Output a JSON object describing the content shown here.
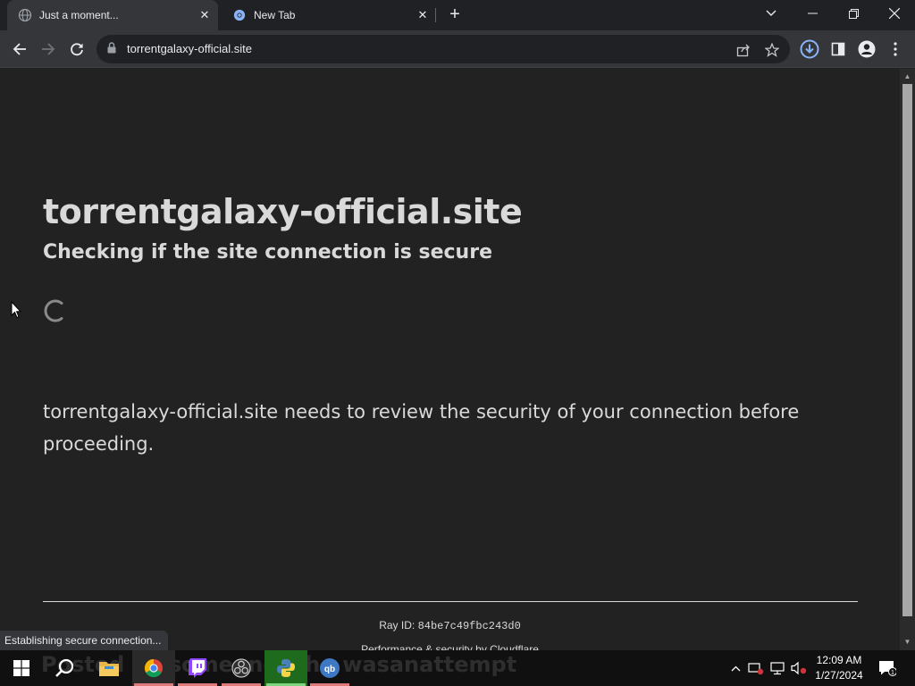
{
  "browser": {
    "tabs": [
      {
        "title": "Just a moment...",
        "active": true,
        "icon": "globe-icon"
      },
      {
        "title": "New Tab",
        "active": false,
        "icon": "chrome-icon"
      }
    ],
    "address_bar": {
      "url": "torrentgalaxy-official.site"
    },
    "status_text": "Establishing secure connection...",
    "colors": {
      "frame": "#202124",
      "toolbar": "#35363a",
      "download_accent": "#8ab4f8"
    }
  },
  "page": {
    "heading": "torrentgalaxy-official.site",
    "subheading": "Checking if the site connection is secure",
    "message": "torrentgalaxy-official.site needs to review the security of your connection before proceeding.",
    "ray_label": "Ray ID:",
    "ray_id": "84be7c49fbc243d0",
    "footer_prefix": "Performance & security by",
    "footer_brand": "Cloudflare",
    "colors": {
      "background": "#222222",
      "text": "#d9d9d9"
    }
  },
  "taskbar": {
    "apps": [
      "start-icon",
      "search-icon",
      "file-explorer-icon",
      "chrome-icon",
      "twitch-icon",
      "obs-icon",
      "python-icon",
      "qbittorrent-icon"
    ],
    "watermark": "Posted by someone who wasanattempt",
    "qbittorrent_label": "qb",
    "time": "12:09 AM",
    "date": "1/27/2024",
    "notification_count": "1"
  }
}
